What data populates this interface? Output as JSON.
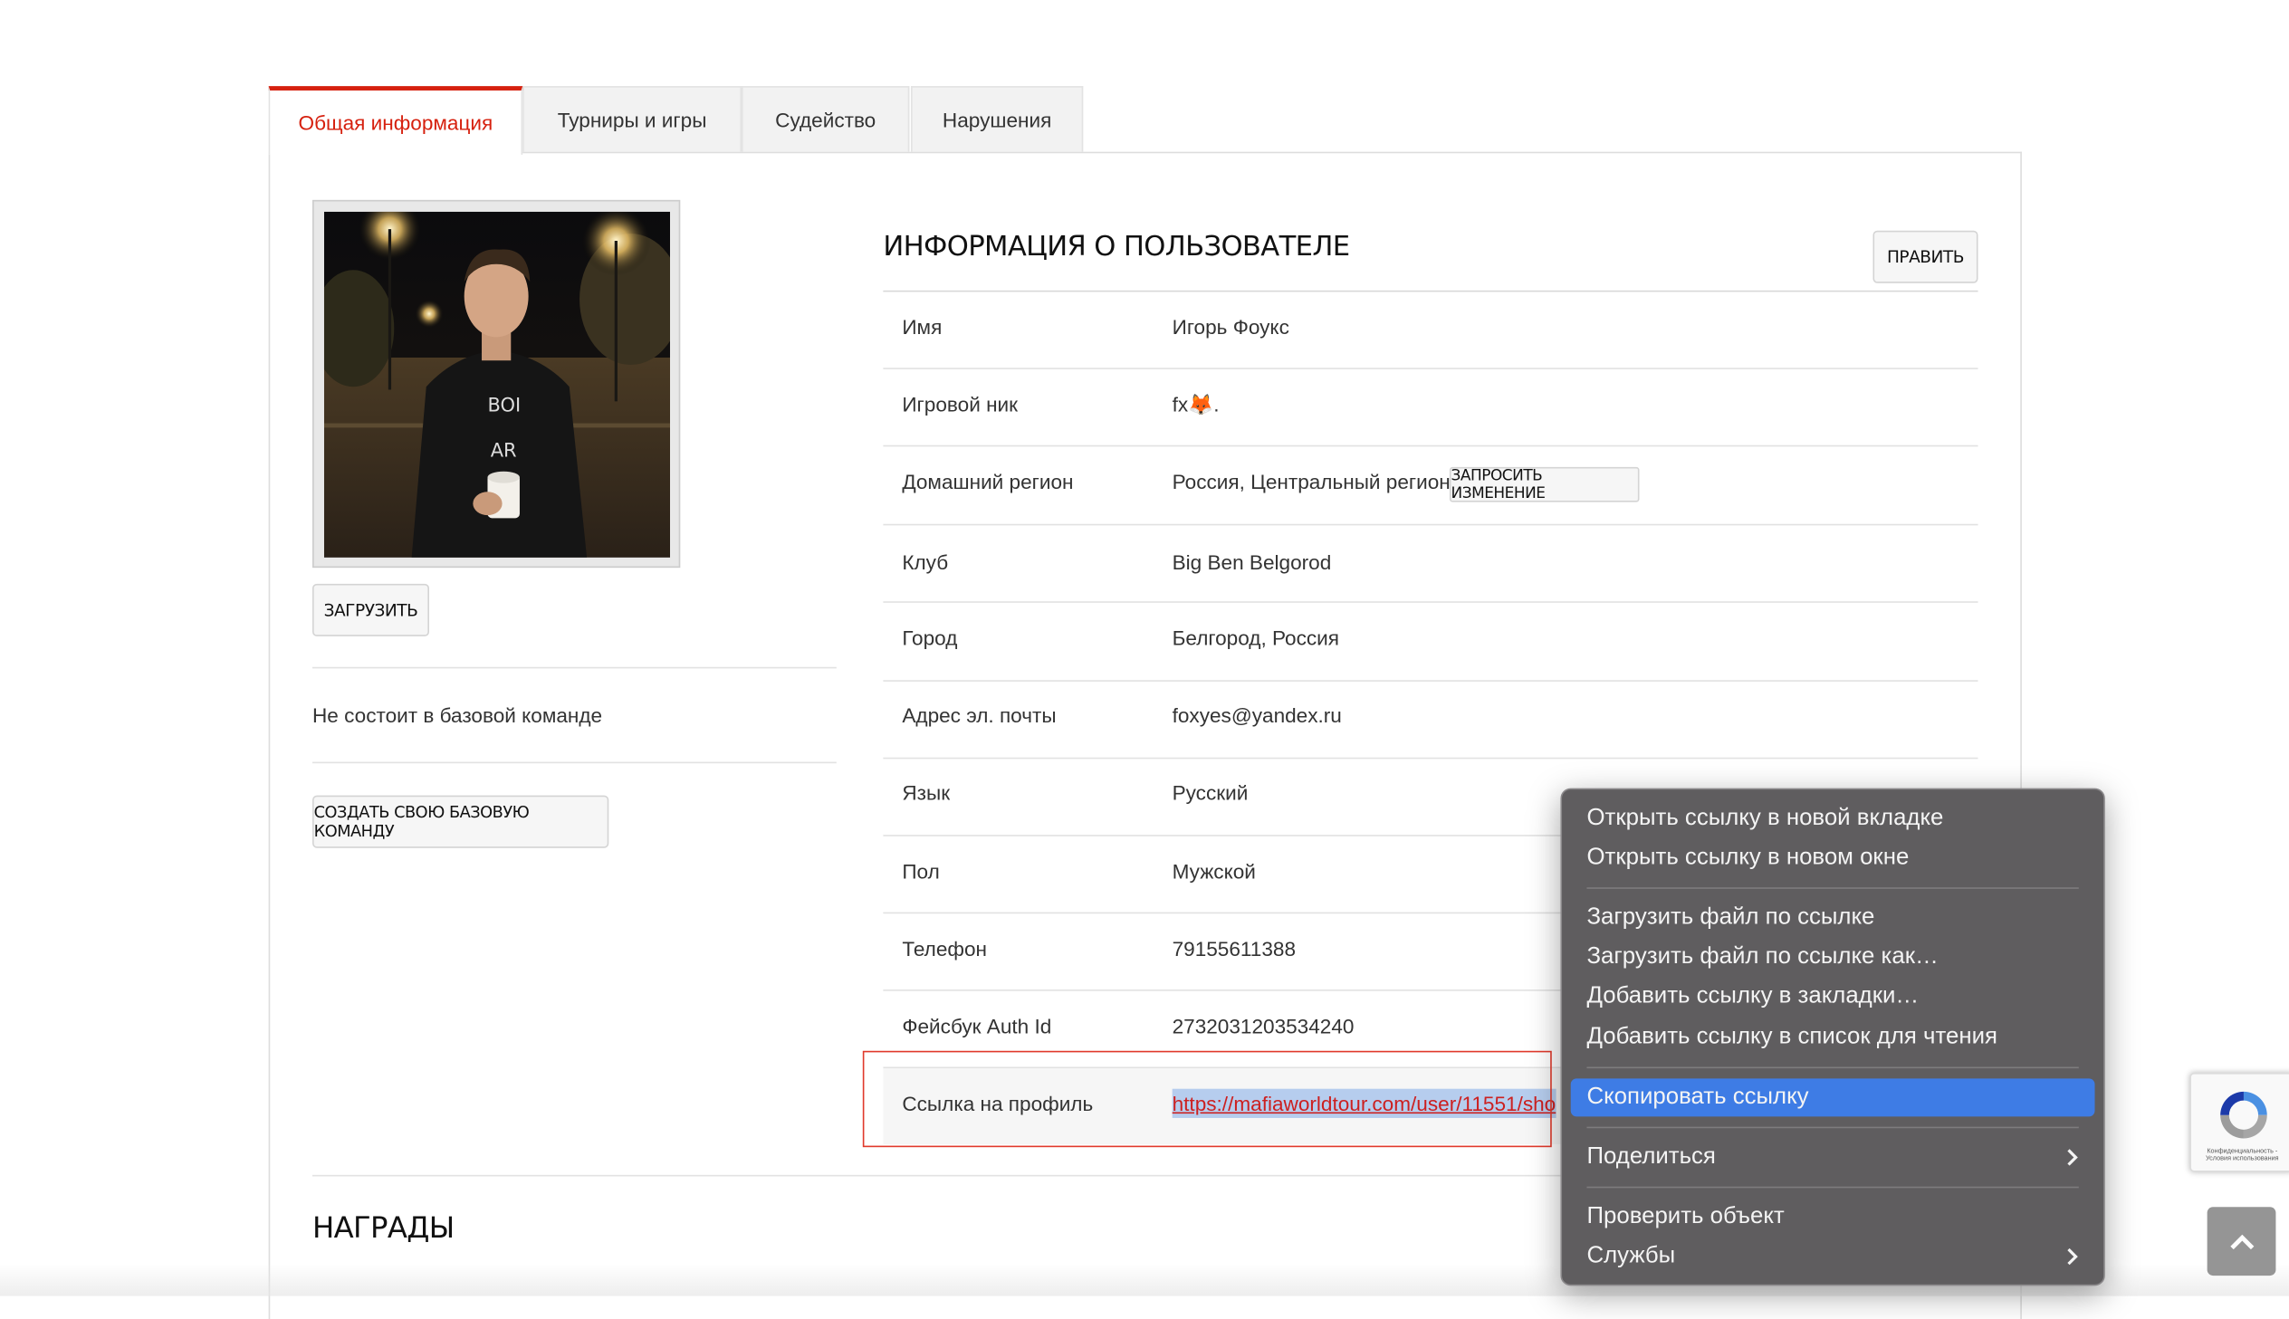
{
  "tabs": {
    "general": "Общая информация",
    "tournaments": "Турниры и игры",
    "judging": "Судейство",
    "violations": "Нарушения"
  },
  "sidebar": {
    "upload_button": "ЗАГРУЗИТЬ",
    "team_status": "Не состоит в базовой команде",
    "create_team_button": "СОЗДАТЬ СВОЮ БАЗОВУЮ КОМАНДУ",
    "photo_shirt_text_1": "BOI",
    "photo_shirt_text_2": "AR"
  },
  "info": {
    "title": "ИНФОРМАЦИЯ О ПОЛЬЗОВАТЕЛЕ",
    "edit_button": "ПРАВИТЬ",
    "request_change_button": "ЗАПРОСИТЬ ИЗМЕНЕНИЕ",
    "rows": [
      {
        "label": "Имя",
        "value": "Игорь Фоукс"
      },
      {
        "label": "Игровой ник",
        "value": "fx🦊."
      },
      {
        "label": "Домашний регион",
        "value": "Россия, Центральный регион"
      },
      {
        "label": "Клуб",
        "value": "Big Ben Belgorod"
      },
      {
        "label": "Город",
        "value": "Белгород, Россия"
      },
      {
        "label": "Адрес эл. почты",
        "value": "foxyes@yandex.ru"
      },
      {
        "label": "Язык",
        "value": "Русский"
      },
      {
        "label": "Пол",
        "value": "Мужской"
      },
      {
        "label": "Телефон",
        "value": "79155611388"
      },
      {
        "label": "Фейсбук Auth Id",
        "value": "2732031203534240"
      },
      {
        "label": "Ссылка на профиль",
        "value": "https://mafiaworldtour.com/user/11551/sho"
      }
    ]
  },
  "awards": {
    "title": "НАГРАДЫ"
  },
  "context_menu": {
    "items": [
      "Открыть ссылку в новой вкладке",
      "Открыть ссылку в новом окне",
      "Загрузить файл по ссылке",
      "Загрузить файл по ссылке как…",
      "Добавить ссылку в закладки…",
      "Добавить ссылку в список для чтения",
      "Скопировать ссылку",
      "Поделиться",
      "Проверить объект",
      "Службы"
    ]
  },
  "recaptcha": {
    "caption": "Конфиденциальность - Условия использования"
  },
  "colors": {
    "accent": "#d6200e",
    "menu_bg": "#5f5d5f",
    "menu_highlight": "#3e7ce5",
    "highlight_box": "#e0392b",
    "link": "#cc2020"
  }
}
